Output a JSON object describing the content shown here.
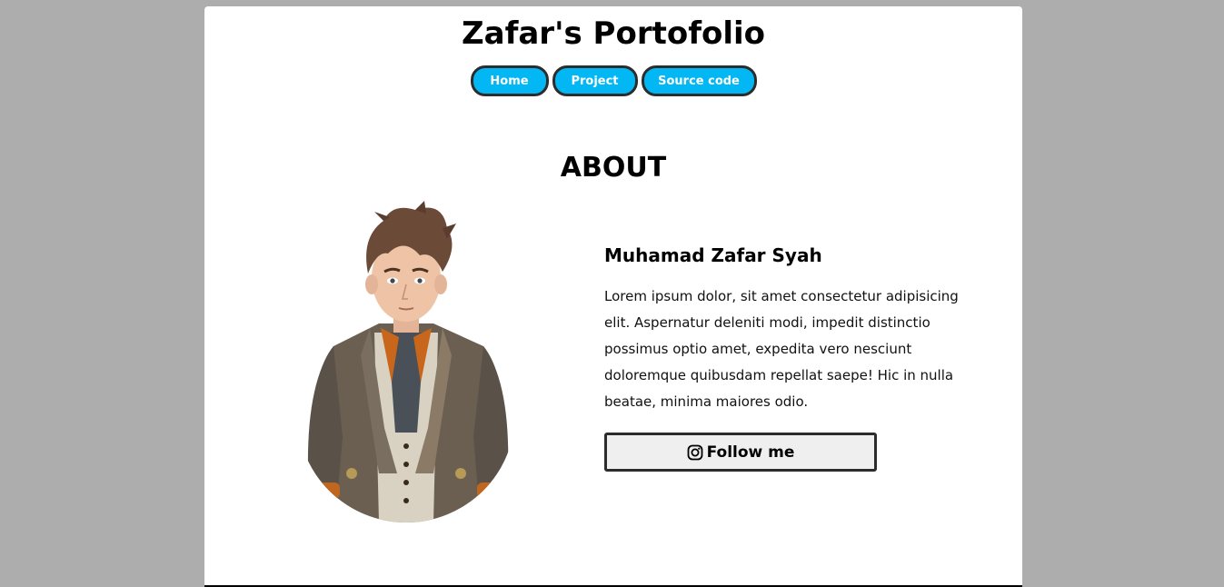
{
  "header": {
    "title": "Zafar's Portofolio"
  },
  "nav": {
    "items": [
      {
        "label": "Home"
      },
      {
        "label": "Project"
      },
      {
        "label": "Source code"
      }
    ],
    "button_color": "#02b7f3",
    "border_color": "#2c2c2c"
  },
  "about": {
    "heading": "ABOUT",
    "name": "Muhamad Zafar Syah",
    "bio": "Lorem ipsum dolor, sit amet consectetur adipisicing elit. Aspernatur deleniti modi, impedit distinctio possimus optio amet, expedita vero nesciunt doloremque quibusdam repellat saepe! Hic in nulla beatae, minima maiores odio.",
    "follow_label": "Follow me",
    "follow_icon": "instagram-icon",
    "avatar_icon": "avatar-illustration"
  },
  "colors": {
    "background": "#adadad",
    "card": "#ffffff"
  }
}
